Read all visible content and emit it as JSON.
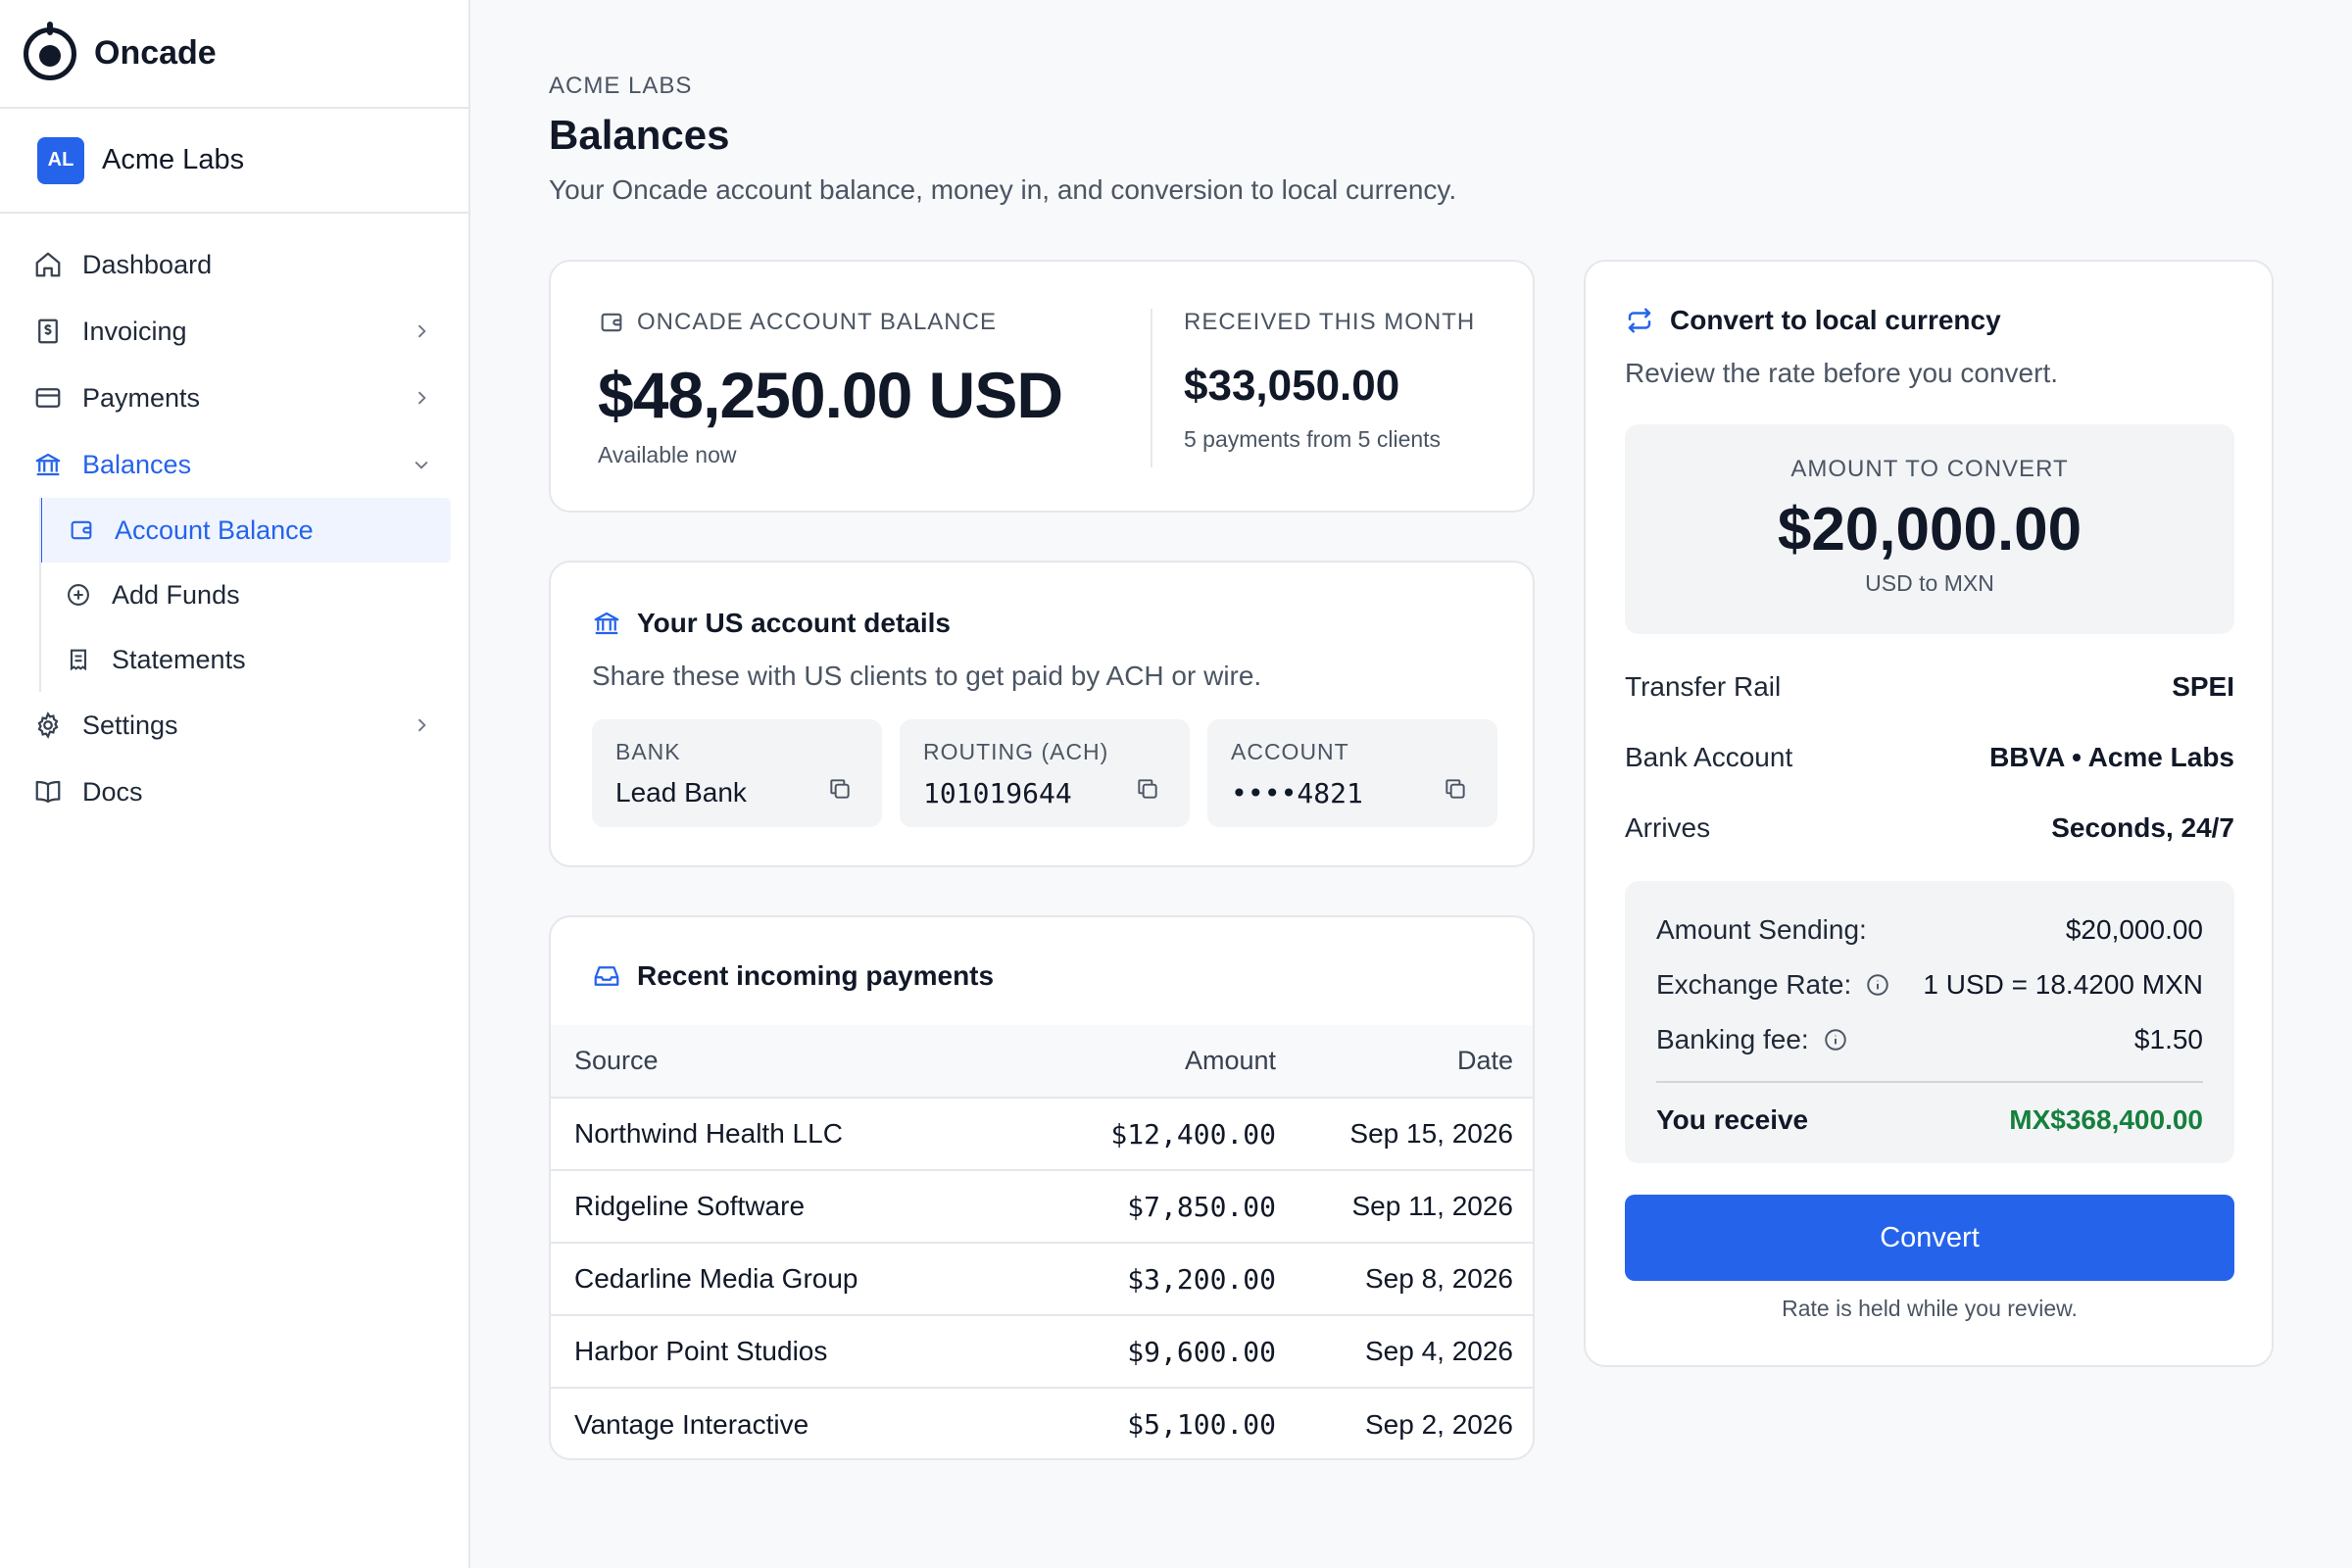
{
  "brand": {
    "name": "Oncade"
  },
  "org": {
    "initials": "AL",
    "name": "Acme Labs"
  },
  "nav": {
    "dashboard": "Dashboard",
    "invoicing": "Invoicing",
    "payments": "Payments",
    "balances": "Balances",
    "sub": {
      "account_balance": "Account Balance",
      "add_funds": "Add Funds",
      "statements": "Statements"
    },
    "settings": "Settings",
    "docs": "Docs"
  },
  "header": {
    "eyebrow": "ACME LABS",
    "title": "Balances",
    "subtitle": "Your Oncade account balance, money in, and conversion to local currency."
  },
  "balance": {
    "label": "ONCADE ACCOUNT BALANCE",
    "amount": "$48,250.00 USD",
    "note": "Available now",
    "received_label": "RECEIVED THIS MONTH",
    "received_amount": "$33,050.00",
    "received_note": "5 payments from 5 clients"
  },
  "us_account": {
    "title": "Your US account details",
    "subtitle": "Share these with US clients to get paid by ACH or wire.",
    "tiles": [
      {
        "label": "BANK",
        "value": "Lead Bank"
      },
      {
        "label": "ROUTING (ACH)",
        "value": "101019644"
      },
      {
        "label": "ACCOUNT",
        "value": "••••4821"
      }
    ]
  },
  "payments": {
    "title": "Recent incoming payments",
    "columns": {
      "source": "Source",
      "amount": "Amount",
      "date": "Date"
    },
    "rows": [
      {
        "source": "Northwind Health LLC",
        "amount": "$12,400.00",
        "date": "Sep 15, 2026"
      },
      {
        "source": "Ridgeline Software",
        "amount": "$7,850.00",
        "date": "Sep 11, 2026"
      },
      {
        "source": "Cedarline Media Group",
        "amount": "$3,200.00",
        "date": "Sep 8, 2026"
      },
      {
        "source": "Harbor Point Studios",
        "amount": "$9,600.00",
        "date": "Sep 4, 2026"
      },
      {
        "source": "Vantage Interactive",
        "amount": "$5,100.00",
        "date": "Sep 2, 2026"
      }
    ]
  },
  "convert": {
    "title": "Convert to local currency",
    "subtitle": "Review the rate before you convert.",
    "amount_label": "AMOUNT TO CONVERT",
    "amount": "$20,000.00",
    "pair": "USD to MXN",
    "details": [
      {
        "key": "Transfer Rail",
        "value": "SPEI"
      },
      {
        "key": "Bank Account",
        "value": "BBVA • Acme Labs"
      },
      {
        "key": "Arrives",
        "value": "Seconds, 24/7"
      }
    ],
    "summary": {
      "sending_label": "Amount Sending:",
      "sending_value": "$20,000.00",
      "rate_label": "Exchange Rate:",
      "rate_value": "1 USD = 18.4200 MXN",
      "fee_label": "Banking fee:",
      "fee_value": "$1.50",
      "receive_label": "You receive",
      "receive_value": "MX$368,400.00"
    },
    "button": "Convert",
    "hold_note": "Rate is held while you review."
  },
  "colors": {
    "accent": "#2563eb",
    "positive": "#15803d",
    "text": "#111827",
    "muted": "#4b5563",
    "border": "#e5e7eb"
  },
  "icons": [
    "home-icon",
    "invoice-icon",
    "card-icon",
    "bank-icon",
    "wallet-icon",
    "plus-circle-icon",
    "receipt-icon",
    "gear-icon",
    "book-icon",
    "chevron-right-icon",
    "chevron-down-icon",
    "copy-icon",
    "inbox-icon",
    "swap-icon",
    "info-icon"
  ]
}
